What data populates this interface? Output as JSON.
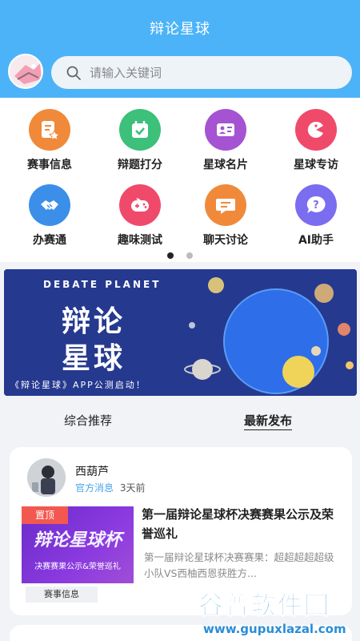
{
  "header": {
    "title": "辩论星球"
  },
  "search": {
    "placeholder": "请输入关键词"
  },
  "menu": {
    "items": [
      {
        "label": "赛事信息",
        "icon": "document-star-icon",
        "color": "#f08a3a"
      },
      {
        "label": "辩题打分",
        "icon": "calendar-check-icon",
        "color": "#3cc07a"
      },
      {
        "label": "星球名片",
        "icon": "id-card-icon",
        "color": "#a553d2"
      },
      {
        "label": "星球专访",
        "icon": "pacman-icon",
        "color": "#f04a6b"
      },
      {
        "label": "办赛通",
        "icon": "handshake-icon",
        "color": "#3b8fe8"
      },
      {
        "label": "趣味测试",
        "icon": "gamepad-icon",
        "color": "#f04a6b"
      },
      {
        "label": "聊天讨论",
        "icon": "chat-bubble-icon",
        "color": "#f08a3a"
      },
      {
        "label": "AI助手",
        "icon": "question-chat-icon",
        "color": "#7b6df0"
      }
    ],
    "page_indicator": {
      "current": 1,
      "total": 2
    }
  },
  "banner": {
    "title": "DEBATE PLANET",
    "line1": "辩论",
    "line2": "星球",
    "subtitle": "《辩论星球》APP公测启动！"
  },
  "tabs": [
    {
      "label": "综合推荐",
      "active": false
    },
    {
      "label": "最新发布",
      "active": true
    }
  ],
  "post": {
    "author": "西葫芦",
    "source": "官方消息",
    "time": "3天前",
    "pin_label": "置顶",
    "thumb_big": "辩论星球杯",
    "thumb_small": "决赛赛果公示&荣誉巡礼",
    "tag": "赛事信息",
    "title": "第一届辩论星球杯决赛赛果公示及荣誉巡礼",
    "summary": "第一届辩论星球杯决赛赛果：超超超超超级小队VS西柚西恩获胜方..."
  },
  "watermark": {
    "cn": "谷普软件园",
    "en": "www.gupuxlazal.com"
  }
}
